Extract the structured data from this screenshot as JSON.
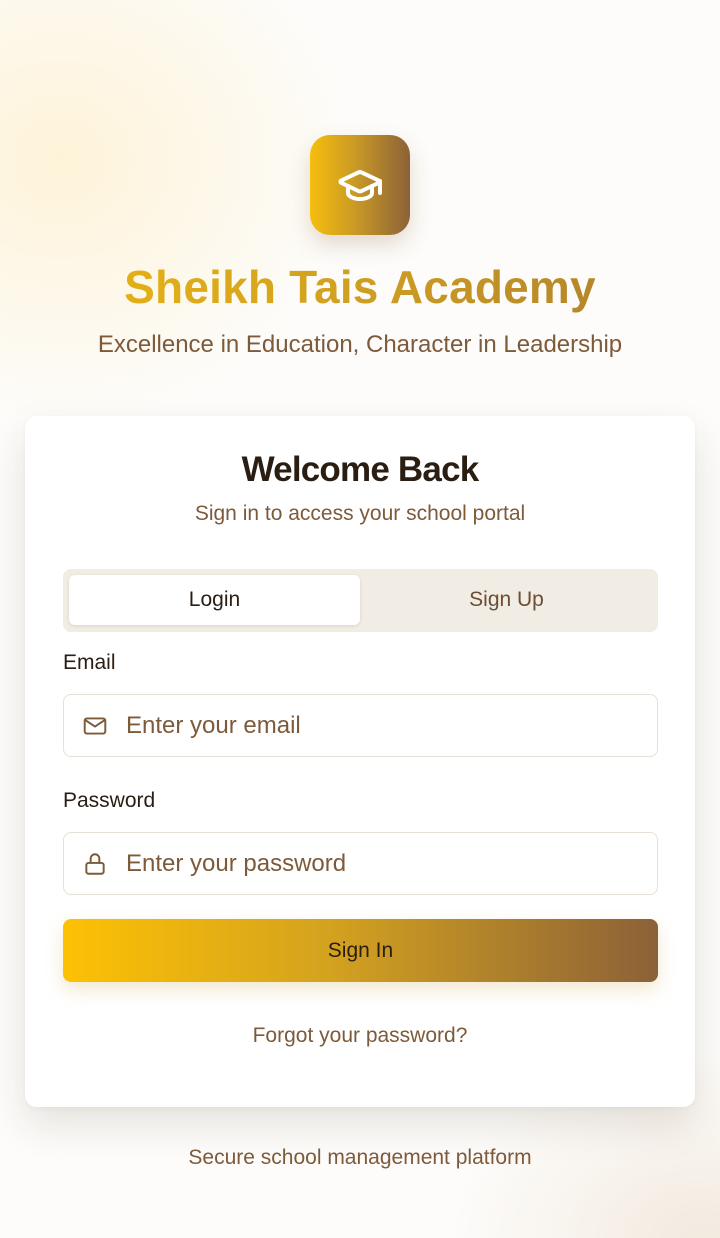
{
  "brand": {
    "logo_icon": "graduation-cap-icon",
    "title": "Sheikh Tais Academy",
    "tagline": "Excellence in Education, Character in Leadership"
  },
  "card": {
    "title": "Welcome Back",
    "subtitle": "Sign in to access your school portal"
  },
  "tabs": {
    "login_label": "Login",
    "signup_label": "Sign Up",
    "active": "Login"
  },
  "form": {
    "email_label": "Email",
    "email_placeholder": "Enter your email",
    "email_value": "",
    "email_icon": "mail-icon",
    "password_label": "Password",
    "password_placeholder": "Enter your password",
    "password_value": "",
    "password_icon": "lock-icon",
    "submit_label": "Sign In",
    "forgot_label": "Forgot your password?"
  },
  "footer": {
    "note": "Secure school management platform"
  },
  "colors": {
    "accent_gold": "#f6be0e",
    "accent_brown": "#8c6138",
    "text_dark": "#2a1d12",
    "text_muted": "#7d5a3a",
    "tab_track": "#f1ece4"
  }
}
